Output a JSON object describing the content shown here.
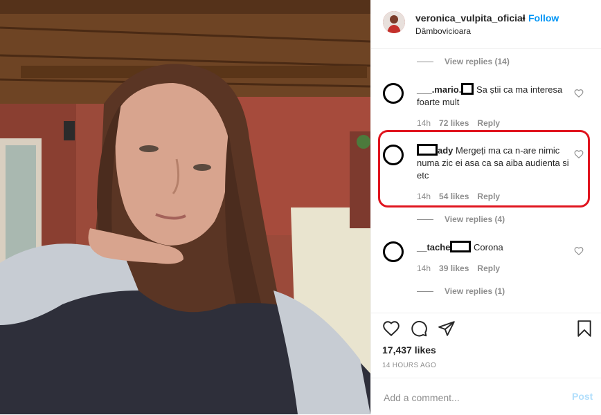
{
  "header": {
    "username": "veronica_vulpita_oficial",
    "separator": "•",
    "follow_label": "Follow",
    "location": "Dâmbovicioara"
  },
  "comments": {
    "replies_1": "View replies (14)",
    "c1": {
      "user": "___.mario.",
      "text": "Sa știi ca ma interesa foarte mult",
      "time": "14h",
      "likes": "72 likes",
      "reply": "Reply"
    },
    "c2": {
      "user": "ady",
      "text": "Mergeți ma ca n-are nimic numa zic ei asa ca sa aiba audienta si etc",
      "time": "14h",
      "likes": "54 likes",
      "reply": "Reply"
    },
    "replies_2": "View replies (4)",
    "c3": {
      "user": "__tache",
      "text": "Corona",
      "time": "14h",
      "likes": "39 likes",
      "reply": "Reply"
    },
    "replies_3": "View replies (1)"
  },
  "actions": {
    "likes": "17,437 likes",
    "time_ago": "14 HOURS AGO",
    "comment_placeholder": "Add a comment...",
    "post_label": "Post"
  },
  "colors": {
    "link": "#0095f6",
    "highlight": "#e0141e",
    "post_disabled": "#b2dffc",
    "muted": "#8e8e8e"
  },
  "icons": [
    "heart-icon",
    "comment-icon",
    "share-icon",
    "bookmark-icon"
  ]
}
